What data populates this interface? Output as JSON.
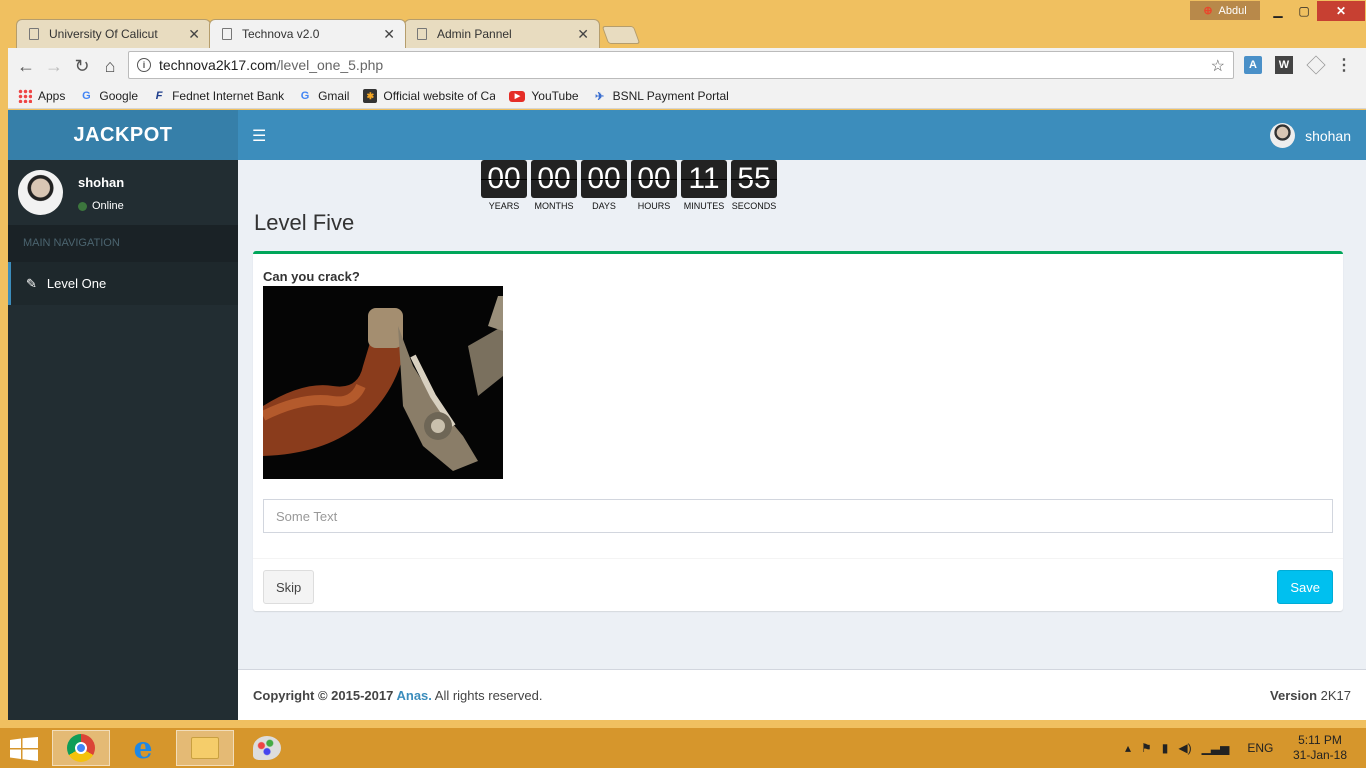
{
  "browser": {
    "profile_name": "Abdul",
    "tabs": [
      {
        "label": "University Of Calicut",
        "active": false
      },
      {
        "label": "Technova v2.0",
        "active": true
      },
      {
        "label": "Admin Pannel",
        "active": false
      }
    ],
    "url_domain": "technova2k17.com",
    "url_path": "/level_one_5.php",
    "bookmarks": [
      {
        "label": "Apps",
        "icon": "apps-grid-icon"
      },
      {
        "label": "Google",
        "icon": "google-icon"
      },
      {
        "label": "Fednet Internet Bank",
        "icon": "fednet-icon"
      },
      {
        "label": "Gmail",
        "icon": "google-icon"
      },
      {
        "label": "Official website of Ca",
        "icon": "joomla-icon"
      },
      {
        "label": "YouTube",
        "icon": "youtube-icon"
      },
      {
        "label": "BSNL Payment Portal",
        "icon": "bsnl-icon"
      }
    ]
  },
  "app": {
    "logo": "JACKPOT",
    "user": {
      "name": "shohan",
      "status": "Online"
    },
    "nav_header": "MAIN NAVIGATION",
    "nav_items": [
      {
        "label": "Level One",
        "icon": "edit-icon"
      }
    ],
    "countdown": [
      {
        "value": "00",
        "label": "YEARS"
      },
      {
        "value": "00",
        "label": "MONTHS"
      },
      {
        "value": "00",
        "label": "DAYS"
      },
      {
        "value": "00",
        "label": "HOURS"
      },
      {
        "value": "11",
        "label": "MINUTES"
      },
      {
        "value": "55",
        "label": "SECONDS"
      }
    ],
    "page_title": "Level Five",
    "question": "Can you crack?",
    "answer_placeholder": "Some Text",
    "skip_label": "Skip",
    "save_label": "Save",
    "footer": {
      "copyright_prefix": "Copyright © 2015-2017 ",
      "brand": "Anas.",
      "rights": " All rights reserved.",
      "version_label": "Version",
      "version_value": " 2K17"
    },
    "colors": {
      "header": "#3c8dbc",
      "sidebar": "#222d32",
      "box_accent": "#00a65a",
      "save": "#00c0ef"
    }
  },
  "taskbar": {
    "lang": "ENG",
    "time": "5:11 PM",
    "date": "31-Jan-18"
  }
}
